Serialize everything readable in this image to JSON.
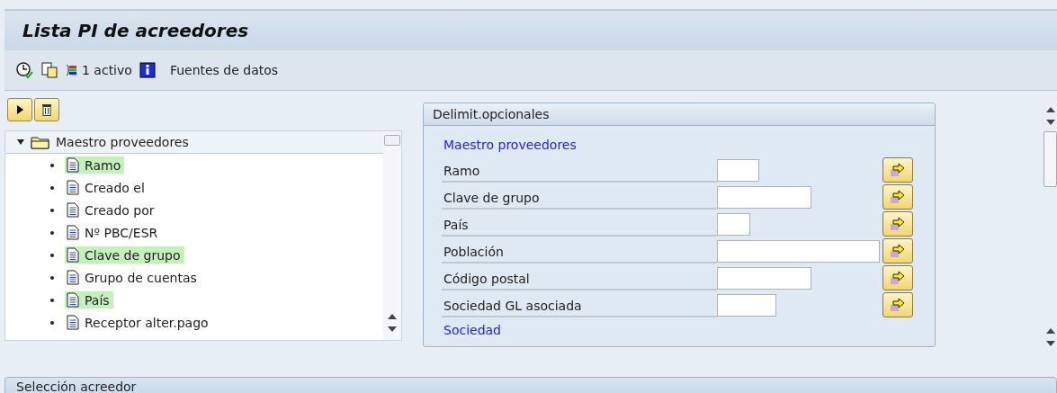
{
  "window": {
    "title": "Lista PI de acreedores"
  },
  "toolbar": {
    "active_count": "1  activo",
    "data_sources": "Fuentes de datos"
  },
  "tree": {
    "root": {
      "label": "Maestro proveedores",
      "expanded": true,
      "children": [
        {
          "label": "Ramo",
          "highlighted": true
        },
        {
          "label": "Creado el",
          "highlighted": false
        },
        {
          "label": "Creado por",
          "highlighted": false
        },
        {
          "label": "Nº PBC/ESR",
          "highlighted": false
        },
        {
          "label": "Clave de grupo",
          "highlighted": true
        },
        {
          "label": "Grupo de cuentas",
          "highlighted": false
        },
        {
          "label": "País",
          "highlighted": true
        },
        {
          "label": "Receptor alter.pago",
          "highlighted": false
        }
      ]
    }
  },
  "selections": {
    "title": "Delimit.opcionales",
    "sections": [
      {
        "heading": "Maestro proveedores",
        "fields": [
          {
            "label": "Ramo"
          },
          {
            "label": "Clave de grupo"
          },
          {
            "label": "País"
          },
          {
            "label": "Población"
          },
          {
            "label": "Código postal"
          },
          {
            "label": "Sociedad GL asociada"
          }
        ]
      },
      {
        "heading": "Sociedad"
      }
    ]
  },
  "bottom_panel": {
    "title": "Selección acreedor"
  }
}
